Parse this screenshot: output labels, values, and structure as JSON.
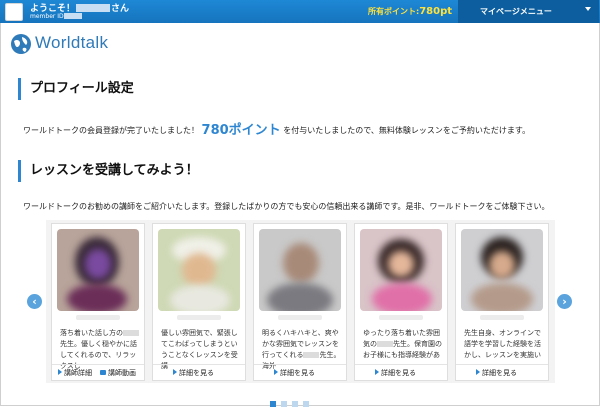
{
  "header": {
    "welcome_prefix": "ようこそ！",
    "welcome_suffix": "さん",
    "member_id_label": "member ID",
    "points_label": "所有ポイント:",
    "points_value": "780pt",
    "menu_label": "マイページメニュー"
  },
  "logo": {
    "text": "Worldtalk"
  },
  "profile": {
    "title": "プロフィール設定",
    "text_before": "ワールドトークの会員登録が完了いたしました！",
    "points": "780ポイント",
    "text_after": "を付与いたしましたので、無料体験レッスンをご予約いただけます。"
  },
  "lessons": {
    "title": "レッスンを受講してみよう！",
    "description": "ワールドトークのお勧めの講師をご紹介いたします。登録したばかりの方でも安心の信頼出来る講師です。是非、ワールドトークをご体験下さい。"
  },
  "tutors": [
    {
      "desc_a": "落ち着いた話し方の",
      "desc_b": "先生。優しく穏やかに話してくれるので、リラックスし",
      "link1": "講師詳細",
      "link2": "講師動画"
    },
    {
      "desc_a": "優しい雰囲気で、緊張してこわばってしまうということなくレッスンを受講",
      "desc_b": "",
      "link1": "詳細を見る"
    },
    {
      "desc_a": "明るくハキハキと、爽やかな雰囲気でレッスンを行ってくれる",
      "desc_b": "先生。海外",
      "link1": "詳細を見る"
    },
    {
      "desc_a": "ゆったり落ち着いた雰囲気の",
      "desc_b": "先生。保育園のお子様にも指導経験があ",
      "link1": "詳細を見る"
    },
    {
      "desc_a": "先生自身、オンラインで語学を学習した経験を活かし、レッスンを実施い",
      "desc_b": "",
      "link1": "詳細を見る"
    }
  ],
  "carousel": {
    "prev_icon": "‹",
    "next_icon": "›",
    "page_count": 4,
    "active_page": 1
  },
  "colors": {
    "accent": "#2e86d1",
    "menu_bg": "#0d5e9e",
    "points_yellow": "#ffe23a"
  }
}
